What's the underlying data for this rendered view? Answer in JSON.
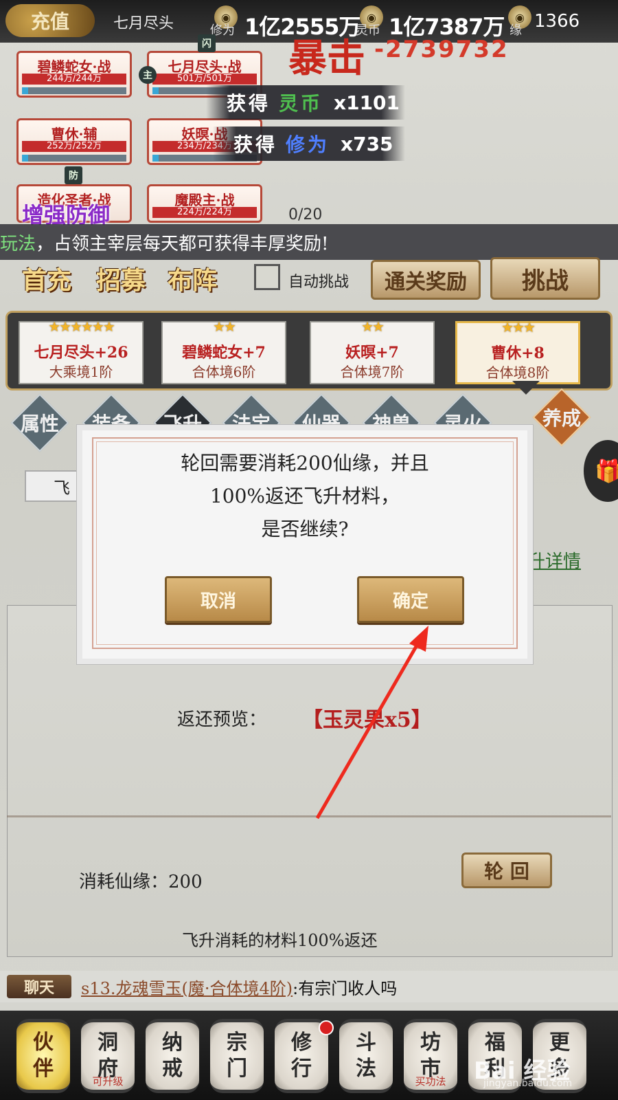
{
  "top_bar": {
    "recharge": "充值",
    "player_name": "七月尽头",
    "cultivation_label": "修为",
    "cultivation_value": "1亿2555万",
    "spirit_label": "灵币",
    "spirit_value": "1亿7387万",
    "fate_label": "缘",
    "fate_value": "1366"
  },
  "combat": {
    "crit_label": "暴击",
    "crit_number": "-2739732"
  },
  "partners": [
    {
      "name": "碧鳞蛇女·战",
      "hp": "244万/244万"
    },
    {
      "name": "七月尽头·战",
      "hp": "501万/501万"
    },
    {
      "name": "曹休·辅",
      "hp": "252万/252万"
    },
    {
      "name": "妖暝·战",
      "hp": "234万/234万"
    },
    {
      "name": "造化圣者·战",
      "hp": ""
    },
    {
      "name": "魔殿主·战",
      "hp": "224万/224万"
    }
  ],
  "badges": {
    "dodge": "闪",
    "main": "主",
    "defense": "防"
  },
  "toasts": [
    {
      "prefix": "获得",
      "item": "灵币",
      "amount": "x1101"
    },
    {
      "prefix": "获得",
      "item": "修为",
      "amount": "x735"
    }
  ],
  "boost_defense": "增强防御",
  "progress_text": "0/20",
  "marquee": {
    "highlight": "玩法",
    "text": "，占领主宰层每天都可获得丰厚奖励!"
  },
  "actions": {
    "first_charge": "首充",
    "recruit": "招募",
    "formation": "布阵",
    "auto_challenge": "自动挑战",
    "clear_reward": "通关奖励",
    "challenge": "挑战"
  },
  "party": [
    {
      "stars": "★★★★★★",
      "name": "七月尽头+26",
      "realm": "大乘境1阶"
    },
    {
      "stars": "★★",
      "name": "碧鳞蛇女+7",
      "realm": "合体境6阶"
    },
    {
      "stars": "★★",
      "name": "妖暝+7",
      "realm": "合体境7阶"
    },
    {
      "stars": "★★★",
      "name": "曹休+8",
      "realm": "合体境8阶"
    }
  ],
  "tabs": [
    "属性",
    "装备",
    "飞升",
    "法宝",
    "仙器",
    "神兽",
    "灵火",
    "养成"
  ],
  "panel": {
    "side_tab": "飞",
    "details_link": "升详情",
    "return_preview_label": "返还预览：",
    "return_preview_value": "【玉灵果x5】",
    "cost_label": "消耗仙缘：",
    "cost_value": "200",
    "reincarnate_button": "轮 回",
    "note": "飞升消耗的材料100%返还"
  },
  "dialog": {
    "line1": "轮回需要消耗200仙缘，并且",
    "line2": "100%返还飞升材料，",
    "line3": "是否继续?",
    "cancel": "取消",
    "confirm": "确定"
  },
  "chat": {
    "tag": "聊天",
    "user": "s13.龙魂雪玉(魔·合体境4阶)",
    "message": ":有宗门收人吗"
  },
  "bottom_nav": [
    {
      "top": "伙",
      "bottom": "伴",
      "sub": ""
    },
    {
      "top": "洞",
      "bottom": "府",
      "sub": "可升级"
    },
    {
      "top": "纳",
      "bottom": "戒",
      "sub": ""
    },
    {
      "top": "宗",
      "bottom": "门",
      "sub": ""
    },
    {
      "top": "修",
      "bottom": "行",
      "sub": ""
    },
    {
      "top": "斗",
      "bottom": "法",
      "sub": ""
    },
    {
      "top": "坊",
      "bottom": "市",
      "sub": "买功法"
    },
    {
      "top": "福",
      "bottom": "利",
      "sub": ""
    },
    {
      "top": "更",
      "bottom": "多",
      "sub": ""
    }
  ],
  "watermark": {
    "main": "Bai 经验",
    "sub": "jingyan.baidu.com"
  },
  "colors": {
    "accent_gold": "#b88a48",
    "crit_red": "#c8281c",
    "hp_red": "#c42c2c"
  }
}
